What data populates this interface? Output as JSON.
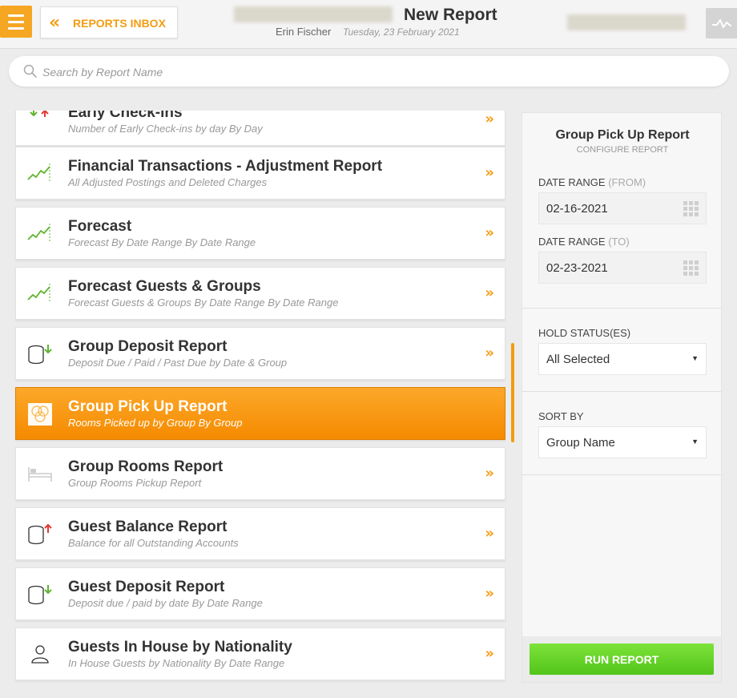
{
  "header": {
    "back_label": "REPORTS INBOX",
    "title": "New Report",
    "user_name": "Erin Fischer",
    "date": "Tuesday, 23 February 2021"
  },
  "search": {
    "placeholder": "Search by Report Name"
  },
  "reports": [
    {
      "name": "Early Check-ins",
      "description": "Number of Early Check-ins by day By Day",
      "icon": "arrows-up-down-icon"
    },
    {
      "name": "Financial Transactions - Adjustment Report",
      "description": "All Adjusted Postings and Deleted Charges",
      "icon": "trend-chart-icon"
    },
    {
      "name": "Forecast",
      "description": "Forecast By Date Range By Date Range",
      "icon": "trend-chart-icon"
    },
    {
      "name": "Forecast Guests & Groups",
      "description": "Forecast Guests & Groups By Date Range By Date Range",
      "icon": "trend-chart-icon"
    },
    {
      "name": "Group Deposit Report",
      "description": "Deposit Due / Paid / Past Due by Date & Group",
      "icon": "coins-down-icon"
    },
    {
      "name": "Group Pick Up Report",
      "description": "Rooms Picked up by Group By Group",
      "icon": "group-circles-icon"
    },
    {
      "name": "Group Rooms Report",
      "description": "Group Rooms Pickup Report",
      "icon": "bed-icon"
    },
    {
      "name": "Guest Balance Report",
      "description": "Balance for all Outstanding Accounts",
      "icon": "coins-up-icon"
    },
    {
      "name": "Guest Deposit Report",
      "description": "Deposit due / paid by date By Date Range",
      "icon": "coins-down-icon"
    },
    {
      "name": "Guests In House by Nationality",
      "description": "In House Guests by Nationality By Date Range",
      "icon": "person-icon"
    }
  ],
  "panel": {
    "title": "Group Pick Up Report",
    "subtitle": "CONFIGURE REPORT",
    "date_from_label": "DATE RANGE",
    "date_from_suffix": "(FROM)",
    "date_from_value": "02-16-2021",
    "date_to_label": "DATE RANGE",
    "date_to_suffix": "(TO)",
    "date_to_value": "02-23-2021",
    "hold_status_label": "HOLD STATUS(ES)",
    "hold_status_value": "All Selected",
    "sort_by_label": "SORT BY",
    "sort_by_value": "Group Name",
    "run_label": "RUN REPORT"
  },
  "colors": {
    "accent": "#f39c12",
    "active_top": "#fca82a",
    "active_bottom": "#f58a00",
    "run_top": "#7de33a",
    "run_bottom": "#52c41a"
  }
}
